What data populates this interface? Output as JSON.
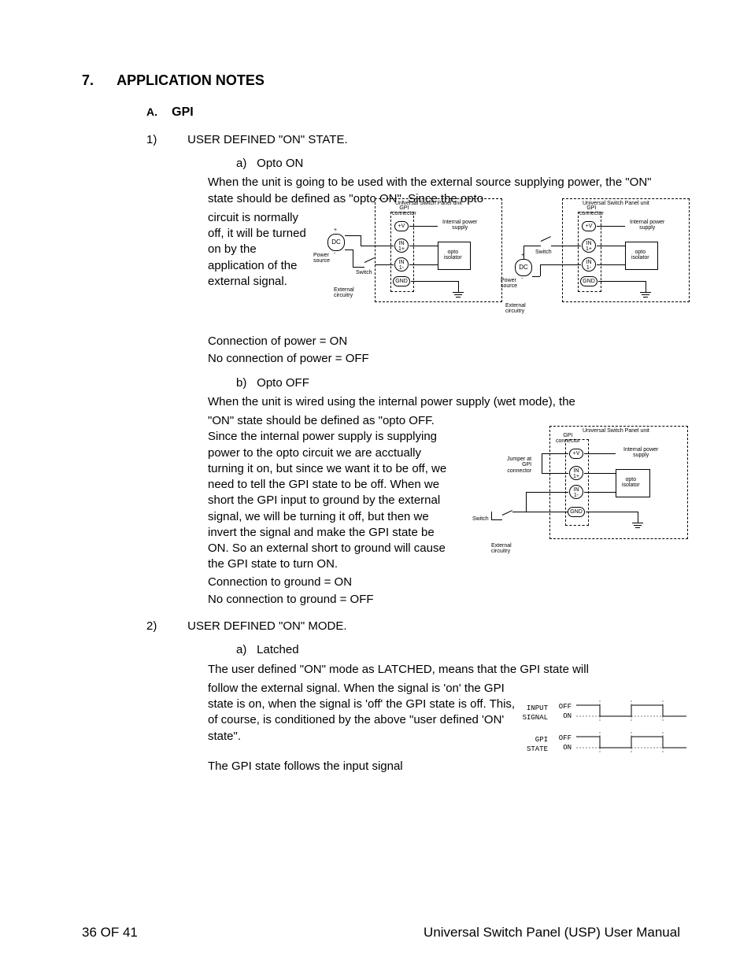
{
  "section": {
    "number": "7.",
    "title": "APPLICATION NOTES"
  },
  "subA": {
    "letter": "A.",
    "title": "GPI"
  },
  "item1": {
    "num": "1)",
    "title": "USER DEFINED \"ON\" STATE.",
    "a": {
      "letter": "a)",
      "title": "Opto ON",
      "intro": "When the unit is going to be used with the external source supplying power, the \"ON\" state should be defined as \"opto ON\".  Since the opto",
      "wrap": "circuit is normally off, it will be turned on by the application of the external signal.",
      "eq1": "Connection of power = ON",
      "eq2": "No connection of power = OFF"
    },
    "b": {
      "letter": "b)",
      "title": "Opto OFF",
      "intro": "When the unit is wired using the internal power supply (wet mode), the",
      "wrap": "\"ON\" state should be defined as \"opto OFF.  Since the internal power supply is supplying power to the opto circuit we are acctually turning it on, but since we want it to be off, we need to tell the GPI state to be off.  When we short the GPI input to ground by the external signal, we will be turning it off, but then we invert the signal and make the GPI state be ON.  So an external short to ground will cause the GPI state to turn ON.",
      "eq1": "Connection to ground = ON",
      "eq2": "No connection to ground = OFF"
    }
  },
  "item2": {
    "num": "2)",
    "title": "USER DEFINED \"ON\" MODE.",
    "a": {
      "letter": "a)",
      "title": "Latched",
      "intro": "The user defined \"ON\" mode as LATCHED, means that the GPI state will",
      "wrap": "follow the external signal.  When the signal is 'on' the GPI state is on, when the signal is 'off' the GPI state is off.  This, of course, is conditioned by the above \"user defined 'ON' state\".",
      "follow": "The GPI state follows the input signal"
    }
  },
  "diagram": {
    "unit_label": "Universal Switch Panel unit",
    "gpi_conn": "GPI\nconnector",
    "plusV": "+V",
    "in1p": "IN\n1+",
    "in1m": "IN\n1-",
    "gnd": "GND",
    "opto": "opto\nisolator",
    "int_ps": "Internal power\nsupply",
    "dc": "DC",
    "plus": "+",
    "minus": "-",
    "power_source": "Power\nsource",
    "switch": "Switch",
    "ext_circ": "External\ncircuitry",
    "jumper": "Jumper at\nGPI\nconnector"
  },
  "timing": {
    "input": "INPUT\nSIGNAL",
    "gpi": "GPI\nSTATE",
    "off": "OFF",
    "on": "ON"
  },
  "footer": {
    "left": "36 OF 41",
    "right": "Universal Switch Panel (USP) User Manual"
  }
}
